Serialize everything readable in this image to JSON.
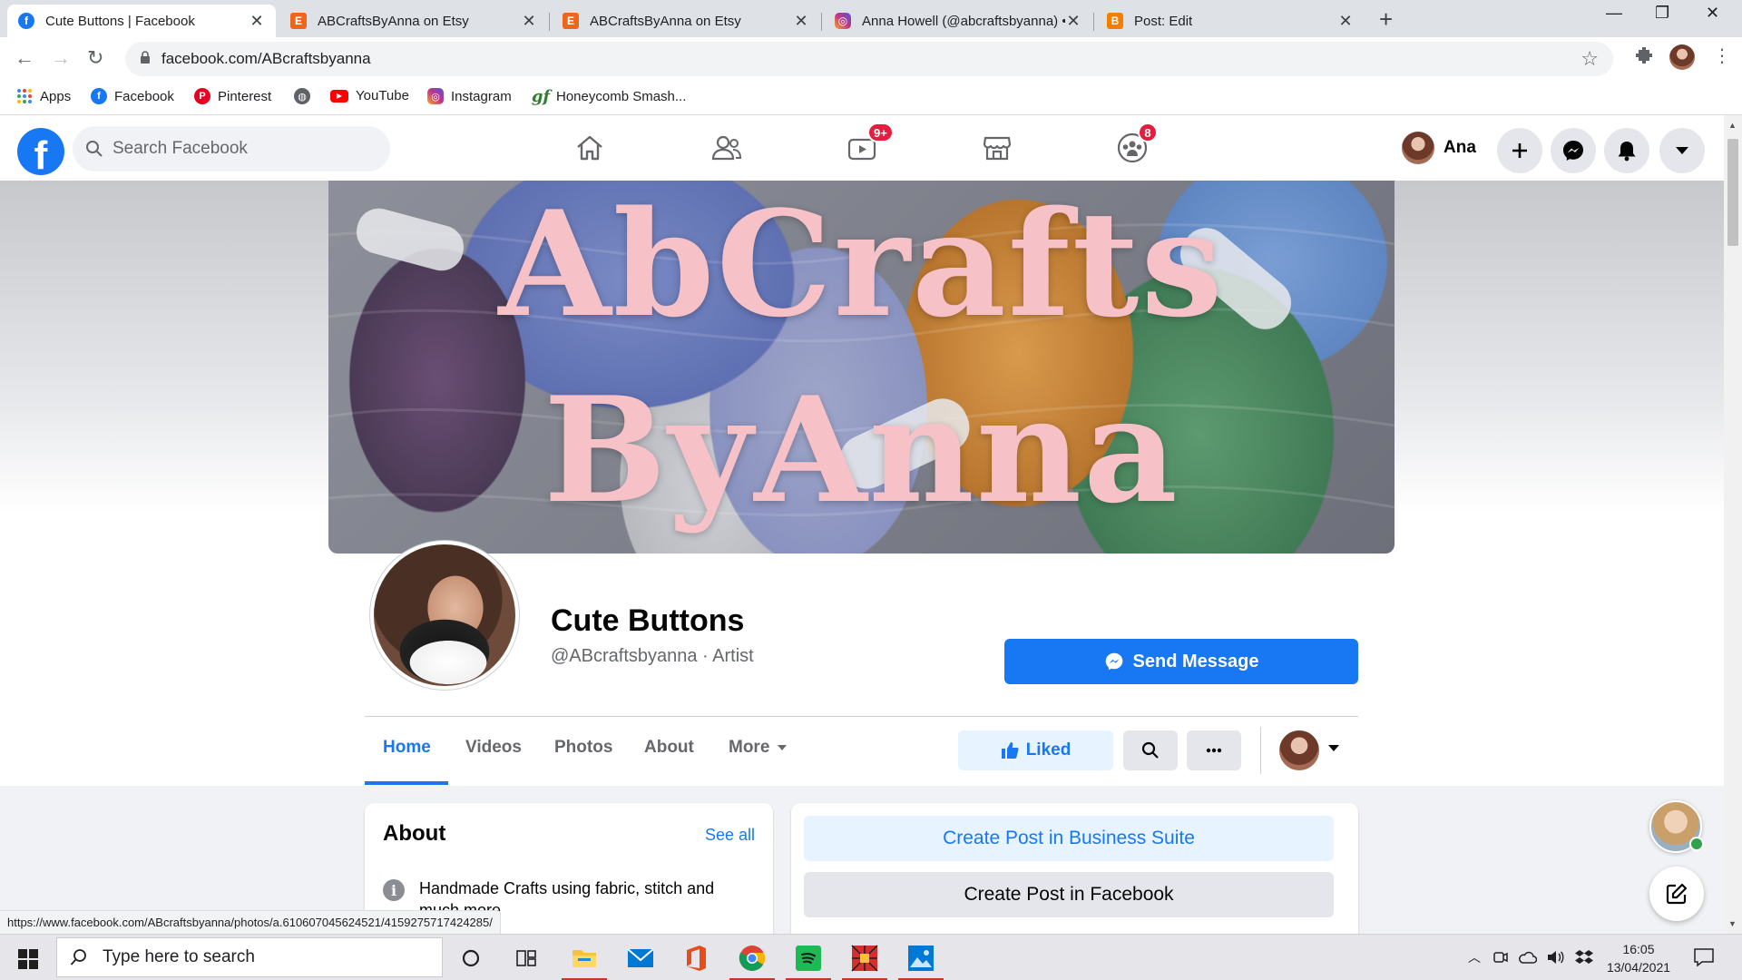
{
  "browser": {
    "tabs": [
      {
        "title": "Cute Buttons | Facebook",
        "favicon": "facebook-icon",
        "color": "#1877f2"
      },
      {
        "title": "ABCraftsByAnna on Etsy",
        "favicon": "etsy-icon",
        "color": "#f1641e"
      },
      {
        "title": "ABCraftsByAnna on Etsy",
        "favicon": "etsy-icon",
        "color": "#f1641e"
      },
      {
        "title": "Anna Howell (@abcraftsbyanna) •",
        "favicon": "instagram-icon",
        "color": "#c13584"
      },
      {
        "title": "Post: Edit",
        "favicon": "blogger-icon",
        "color": "#f57d00"
      }
    ],
    "url": "facebook.com/ABcraftsbyanna",
    "bookmarks": [
      "Apps",
      "Facebook",
      "Pinterest",
      "",
      "YouTube",
      "Instagram",
      "Honeycomb Smash..."
    ],
    "status_url": "https://www.facebook.com/ABcraftsbyanna/photos/a.610607045624521/4159275717424285/"
  },
  "fb": {
    "search_placeholder": "Search Facebook",
    "watch_badge": "9+",
    "groups_badge": "8",
    "user_name": "Ana",
    "accent": "#1877f2"
  },
  "page": {
    "cover_line1": "AbCrafts",
    "cover_line2": "ByAnna",
    "name": "Cute Buttons",
    "handle": "@ABcraftsbyanna · Artist",
    "send_message": "Send Message",
    "tabs": [
      "Home",
      "Videos",
      "Photos",
      "About",
      "More"
    ],
    "liked": "Liked",
    "about_title": "About",
    "see_all": "See all",
    "about_text": "Handmade Crafts using fabric, stitch and much more",
    "create_post_bs": "Create Post in Business Suite",
    "create_post_fb": "Create Post in Facebook"
  },
  "taskbar": {
    "search_placeholder": "Type here to search",
    "time": "16:05",
    "date": "13/04/2021"
  }
}
